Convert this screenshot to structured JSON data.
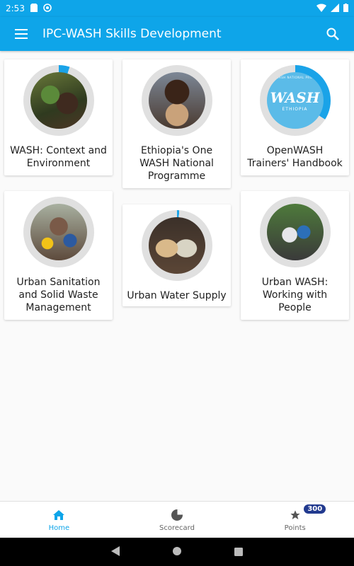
{
  "status": {
    "time": "2:53",
    "left_icons": [
      "sd-card-icon",
      "sync-icon"
    ],
    "right_icons": [
      "wifi-icon",
      "signal-icon",
      "battery-icon"
    ]
  },
  "app_bar": {
    "title": "IPC-WASH Skills Development",
    "accent": "#0ea5e9"
  },
  "courses": [
    {
      "label": "WASH: Context and Environment",
      "progress": 0.05,
      "image": "plant-nursery-photo"
    },
    {
      "label": "Ethiopia's One WASH National Programme",
      "progress": 0.0,
      "image": "child-hands-photo"
    },
    {
      "label": "OpenWASH Trainers' Handbook",
      "progress": 0.34,
      "image": "onewash-logo",
      "logo_text": "WASH",
      "logo_sub": "ETHIOPIA",
      "logo_ring": "ONE WASH NATIONAL PROGRAM"
    },
    {
      "label": "Urban Sanitation and Solid Waste Management",
      "progress": 0.0,
      "image": "market-crowd-photo"
    },
    {
      "label": "Urban Water Supply",
      "progress": 0.01,
      "image": "water-glasses-photo"
    },
    {
      "label": "Urban WASH: Working with People",
      "progress": 0.0,
      "image": "meeting-photo"
    }
  ],
  "bottom_nav": {
    "items": [
      {
        "label": "Home",
        "icon": "home-icon",
        "active": true
      },
      {
        "label": "Scorecard",
        "icon": "pie-chart-icon",
        "active": false
      },
      {
        "label": "Points",
        "icon": "star-icon",
        "active": false,
        "badge": "300"
      }
    ]
  },
  "colors": {
    "progress": "#1aa3e8",
    "track": "#e0e0e0",
    "badge": "#223a8f"
  }
}
